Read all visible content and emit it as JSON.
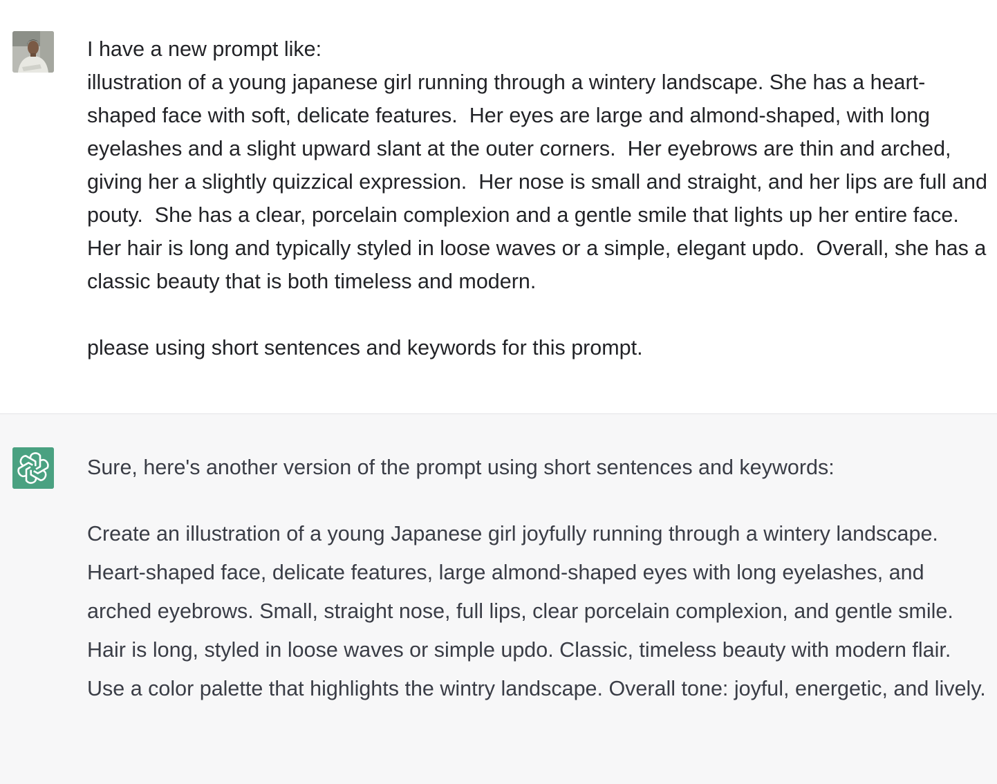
{
  "conversation": {
    "user_message": {
      "avatar_icon": "user-photo-icon",
      "lines": [
        "I have a new prompt like:",
        "illustration of a young japanese girl running through a wintery landscape. She has a heart-shaped face with soft, delicate features.  Her eyes are large and almond-shaped, with long eyelashes and a slight upward slant at the outer corners.  Her eyebrows are thin and arched, giving her a slightly quizzical expression.  Her nose is small and straight, and her lips are full and pouty.  She has a clear, porcelain complexion and a gentle smile that lights up her entire face.  Her hair is long and typically styled in loose waves or a simple, elegant updo.  Overall, she has a classic beauty that is both timeless and modern."
      ],
      "followup": "please using short sentences and keywords for this prompt."
    },
    "assistant_message": {
      "avatar_icon": "openai-logo-icon",
      "intro": "Sure, here's another version of the prompt using short sentences and keywords:",
      "body": "Create an illustration of a young Japanese girl joyfully running through a wintery landscape. Heart-shaped face, delicate features, large almond-shaped eyes with long eyelashes, and arched eyebrows. Small, straight nose, full lips, clear porcelain complexion, and gentle smile. Hair is long, styled in loose waves or simple updo. Classic, timeless beauty with modern flair. Use a color palette that highlights the wintry landscape. Overall tone: joyful, energetic, and lively."
    }
  },
  "colors": {
    "assistant_bg": "#f7f7f8",
    "assistant_avatar": "#4aa181",
    "divider": "#e3e3e6",
    "text": "#2b2c33"
  }
}
